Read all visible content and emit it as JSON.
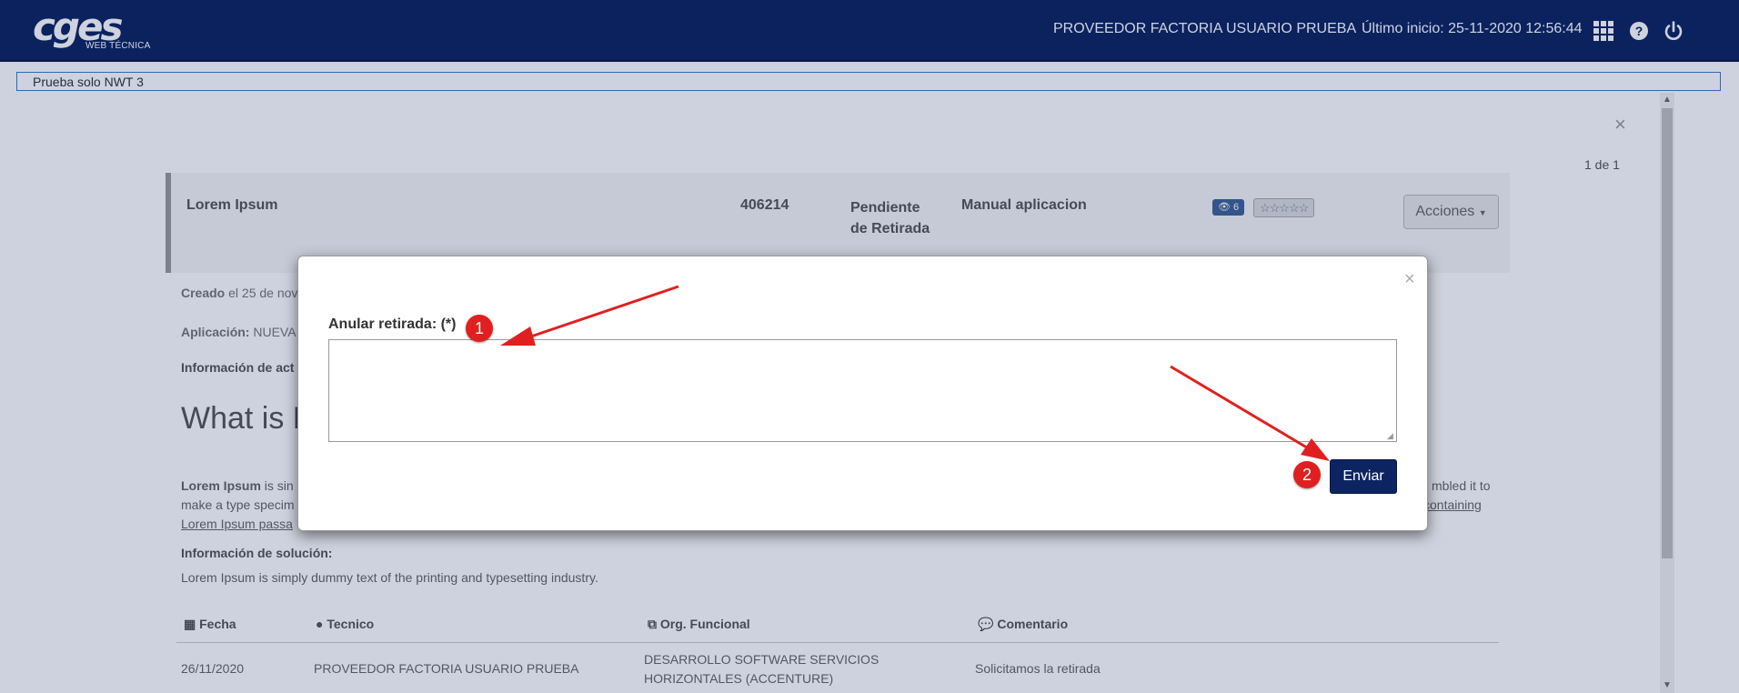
{
  "header": {
    "logo_main": "cges",
    "logo_sub": "WEB TÉCNICA",
    "user_name": "PROVEEDOR FACTORIA USUARIO PRUEBA",
    "last_login": "Último inicio: 25-11-2020 12:56:44",
    "icons": [
      "apps-grid-icon",
      "help-icon",
      "power-icon"
    ]
  },
  "breadcrumb": {
    "value": "Prueba solo NWT 3"
  },
  "background_page": {
    "close_glyph": "×",
    "pager": "1 de 1",
    "record": {
      "name": "Lorem Ipsum",
      "id": "406214",
      "status": "Pendiente de Retirada",
      "type": "Manual aplicacion",
      "views": "6",
      "stars": "☆☆☆☆☆",
      "actions_label": "Acciones"
    },
    "created_label": "Creado",
    "created_text": " el 25 de nov",
    "app_label": "Aplicación:",
    "app_text": " NUEVA",
    "info_label": "Información de act",
    "heading_partial": "What is L",
    "lorem_bold": "Lorem Ipsum",
    "lorem_line1_rest": " is sin",
    "lorem_line2": "make a type specim",
    "lorem_line3": "Lorem Ipsum passa",
    "lorem_right1": "mbled it to",
    "lorem_right2": "containing",
    "solution_label": "Información de solución:",
    "solution_text": "Lorem Ipsum is simply dummy text of the printing and typesetting industry.",
    "table": {
      "headers": [
        "Fecha",
        "Tecnico",
        "Org. Funcional",
        "Comentario"
      ],
      "rows": [
        [
          "26/11/2020",
          "PROVEEDOR FACTORIA USUARIO PRUEBA",
          "DESARROLLO SOFTWARE SERVICIOS",
          "HORIZONTALES (ACCENTURE)",
          "Solicitamos la retirada"
        ]
      ]
    }
  },
  "modal": {
    "close_glyph": "×",
    "field_label": "Anular retirada: (*)",
    "textarea_value": "",
    "submit_label": "Enviar"
  },
  "annotations": {
    "marker_1": "1",
    "marker_2": "2",
    "color": "#e02020"
  },
  "colors": {
    "navy": "#0c2461",
    "overlay": "rgba(10,30,90,0.2)"
  }
}
